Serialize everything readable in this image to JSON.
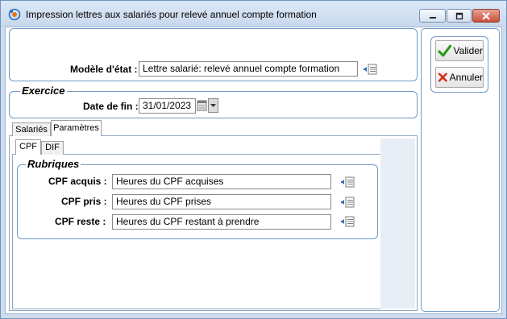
{
  "window": {
    "title": "Impression lettres aux salariés pour relevé annuel compte formation"
  },
  "model": {
    "label": "Modèle d'état :",
    "value": "Lettre salarié: relevé annuel compte formation"
  },
  "exercice": {
    "caption": "Exercice",
    "date_label": "Date de fin :",
    "date_value": "31/01/2023"
  },
  "tabs": {
    "outer": [
      {
        "label": "Salariés",
        "active": false
      },
      {
        "label": "Paramètres",
        "active": true
      }
    ],
    "inner": [
      {
        "label": "CPF",
        "active": true
      },
      {
        "label": "DIF",
        "active": false
      }
    ]
  },
  "rubriques": {
    "caption": "Rubriques",
    "rows": [
      {
        "label": "CPF acquis :",
        "value": "Heures du CPF acquises"
      },
      {
        "label": "CPF pris :",
        "value": "Heures du CPF prises"
      },
      {
        "label": "CPF reste :",
        "value": "Heures du CPF restant à prendre"
      }
    ]
  },
  "actions": {
    "validate": "Valider",
    "cancel": "Annuler"
  },
  "icons": {
    "app": "app-icon",
    "picker": "list-picker-icon",
    "calendar": "calendar-icon",
    "validate": "checkmark-icon",
    "cancel": "red-x-icon"
  }
}
